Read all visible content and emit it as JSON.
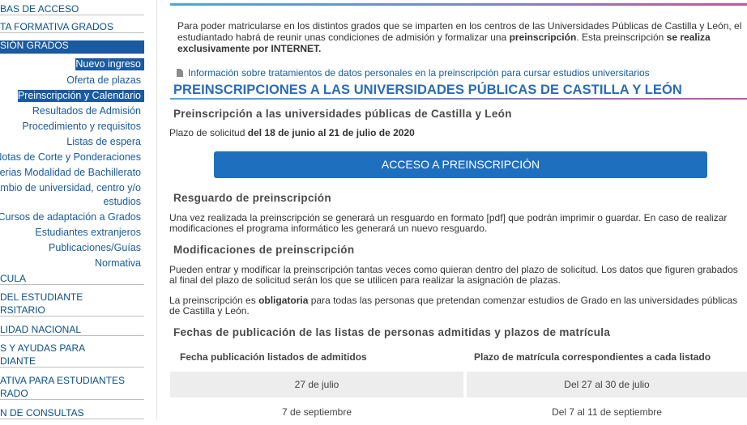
{
  "sidebar": {
    "items": [
      {
        "label": "Pruebas de acceso",
        "display": "BAS DE ACCESO"
      },
      {
        "label": "Oferta formativa grado",
        "display": "TA FORMATIVA GRADOS"
      },
      {
        "label": "Admisión grados",
        "display": "SIÓN GRADOS"
      },
      {
        "label": "Nuevo ingreso"
      },
      {
        "label": "Oferta de plazas"
      },
      {
        "label": "Preinscripción y Calendario"
      },
      {
        "label": "Resultados de Admisión"
      },
      {
        "label": "Procedimiento y requisitos"
      },
      {
        "label": "Listas de espera"
      },
      {
        "label": "Notas de Corte y Ponderaciones"
      },
      {
        "label": "Materias Modalidad de Bachillerato",
        "display": "aterias Modalidad de Bachillerato"
      },
      {
        "label": "Cambio de universidad, centro y/o",
        "display": "ambio de universidad, centro y/o"
      },
      {
        "label": "estudios"
      },
      {
        "label": "Cursos de adaptación a Grados"
      },
      {
        "label": "Estudiantes extranjeros"
      },
      {
        "label": "Publicaciones/Guías"
      },
      {
        "label": "Normativa"
      },
      {
        "label": "Matrícula",
        "display": "CULA"
      },
      {
        "label": "Defensor del estudiante",
        "display": "DEL ESTUDIANTE"
      },
      {
        "label": "universitario",
        "display": "RSITARIO"
      },
      {
        "label": "Movilidad nacional",
        "display": "LIDAD NACIONAL"
      },
      {
        "label": "Becas y ayudas para",
        "display": "S Y AYUDAS PARA"
      },
      {
        "label": "estudiante",
        "display": "DIANTE"
      },
      {
        "label": "Normativa para estudiantes",
        "display": "ATIVA PARA ESTUDIANTES"
      },
      {
        "label": "de grado",
        "display": "RADO"
      },
      {
        "label": "Buzón de consultas",
        "display": "N DE CONSULTAS"
      }
    ]
  },
  "main": {
    "intro_part1": "Para poder matricularse en los distintos grados que se imparten en los centros de las Universidades Públicas de Castilla y León, el estudiantado habrá de reunir unas condiciones de admisión y formalizar una ",
    "intro_bold1": "preinscripción",
    "intro_part2": ". Esta preinscripción ",
    "intro_bold2": "se realiza exclusivamente por INTERNET.",
    "privacy_link": "Información sobre tratamientos de datos personales en la preinscripción para cursar estudios universitarios",
    "heading": "PREINSCRIPCIONES A LAS UNIVERSIDADES PÚBLICAS DE CASTILLA Y LEÓN",
    "subheading": "Preinscripción a las universidades públicas de Castilla y León",
    "deadline_prefix": "Plazo de solicitud ",
    "deadline_value": "del 18 de junio al 21 de julio de 2020",
    "access_button": "ACCESO A PREINSCRIPCIÓN",
    "receipt_title": "Resguardo de preinscripción",
    "receipt_text": "Una vez realizada la preinscripción se generará un resguardo en formato [pdf] que podrán imprimir o guardar. En caso de realizar modificaciones el programa informático les generará un nuevo resguardo.",
    "mods_title": "Modificaciones de preinscripción",
    "mods_text": "Pueden entrar y modificar la preinscripción tantas veces como quieran dentro del plazo de solicitud. Los datos que figuren grabados al final del plazo de solicitud serán los que se utilicen para realizar la asignación de plazas.",
    "mandatory_part1": "La preinscripción es ",
    "mandatory_bold": "obligatoria",
    "mandatory_part2": " para todas las personas que pretendan comenzar estudios de Grado en las universidades públicas de Castilla y León.",
    "dates_title": "Fechas de publicación de las listas de personas admitidas y plazos de matrícula",
    "table": {
      "headers": [
        "Fecha publicación listados de admitidos",
        "Plazo de matrícula correspondientes a cada listado"
      ],
      "rows": [
        [
          "27 de julio",
          "Del 27 al 30 de julio"
        ],
        [
          "7 de septiembre",
          "Del 7 al 11 de septiembre"
        ]
      ]
    }
  }
}
